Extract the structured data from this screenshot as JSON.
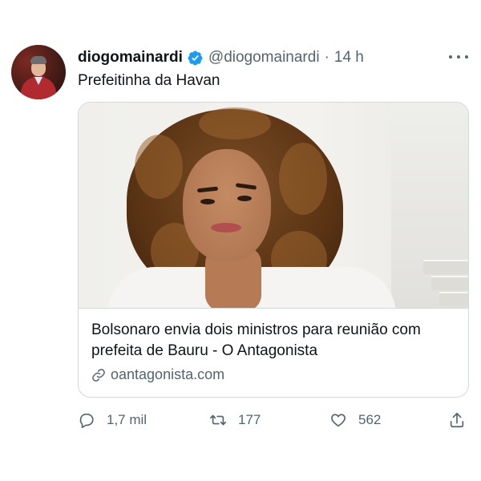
{
  "tweet": {
    "display_name": "diogomainardi",
    "handle": "@diogomainardi",
    "separator": "·",
    "time": "14 h",
    "text": "Prefeitinha da Havan"
  },
  "card": {
    "title": "Bolsonaro envia dois ministros para reunião com prefeita de Bauru - O Antagonista",
    "domain": "oantagonista.com"
  },
  "actions": {
    "replies": "1,7 mil",
    "retweets": "177",
    "likes": "562"
  },
  "colors": {
    "verified": "#1d9bf0",
    "secondary_text": "#536471",
    "primary_text": "#0f1419",
    "border": "#cfd9de"
  },
  "icons": [
    "verified-badge-icon",
    "more-icon",
    "link-icon",
    "reply-icon",
    "retweet-icon",
    "like-icon",
    "share-icon"
  ]
}
